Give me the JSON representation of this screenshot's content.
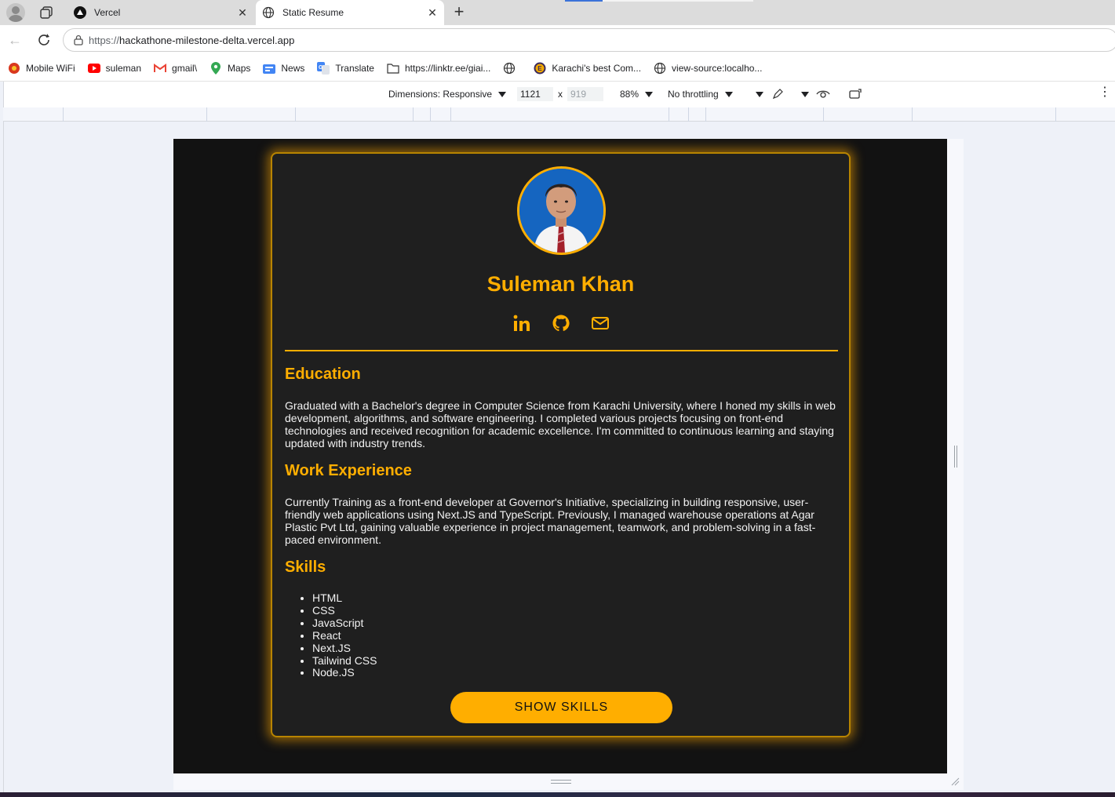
{
  "browser": {
    "tabs": [
      {
        "title": "Vercel",
        "active": false
      },
      {
        "title": "Static Resume",
        "active": true
      }
    ],
    "url_scheme": "https://",
    "url_host": "hackathone-milestone-delta.vercel.app",
    "bookmarks": [
      {
        "label": "Mobile WiFi",
        "icon": "wifi-icon"
      },
      {
        "label": "suleman",
        "icon": "youtube-icon"
      },
      {
        "label": "gmail\\",
        "icon": "gmail-icon"
      },
      {
        "label": "Maps",
        "icon": "maps-icon"
      },
      {
        "label": "News",
        "icon": "news-icon"
      },
      {
        "label": "Translate",
        "icon": "translate-icon"
      },
      {
        "label": "https://linktr.ee/giai...",
        "icon": "folder-icon"
      },
      {
        "label": "",
        "icon": "globe-icon"
      },
      {
        "label": "Karachi's best Com...",
        "icon": "site-icon"
      },
      {
        "label": "view-source:localho...",
        "icon": "globe-icon"
      }
    ]
  },
  "devtools": {
    "dimensions_label": "Dimensions: Responsive",
    "width": "1121",
    "height_placeholder": "919",
    "times": "x",
    "zoom": "88%",
    "throttling": "No throttling"
  },
  "resume": {
    "name": "Suleman Khan",
    "socials": [
      "linkedin-icon",
      "github-icon",
      "mail-icon"
    ],
    "education_title": "Education",
    "education_text": "Graduated with a Bachelor's degree in Computer Science from Karachi University, where I honed my skills in web development, algorithms, and software engineering. I completed various projects focusing on front-end technologies and received recognition for academic excellence. I'm committed to continuous learning and staying updated with industry trends.",
    "work_title": "Work Experience",
    "work_text": "Currently Training as a front-end developer at Governor's Initiative, specializing in building responsive, user-friendly web applications using Next.JS and TypeScript. Previously, I managed warehouse operations at Agar Plastic Pvt Ltd, gaining valuable experience in project management, teamwork, and problem-solving in a fast-paced environment.",
    "skills_title": "Skills",
    "skills": [
      "HTML",
      "CSS",
      "JavaScript",
      "React",
      "Next.JS",
      "Tailwind CSS",
      "Node.JS"
    ],
    "button_label": "SHOW SKILLS"
  },
  "colors": {
    "accent": "#ffae00",
    "card_bg": "#1f1f1f",
    "page_bg": "#121212"
  }
}
